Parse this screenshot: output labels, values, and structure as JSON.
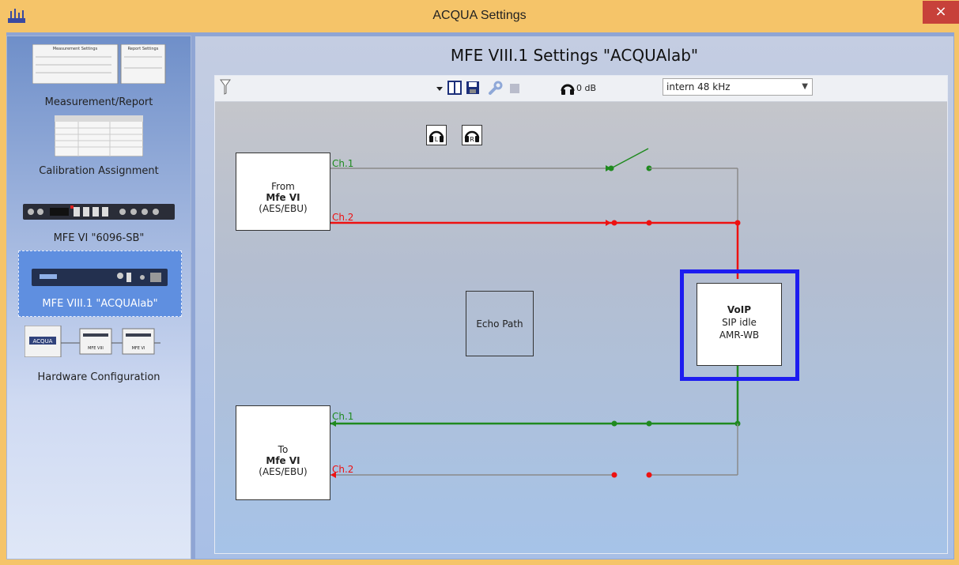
{
  "window": {
    "title": "ACQUA Settings",
    "close_glyph": "×"
  },
  "sidebar": {
    "items": [
      {
        "label": "Measurement/Report",
        "selected": false
      },
      {
        "label": "Calibration Assignment",
        "selected": false
      },
      {
        "label": "MFE VI \"6096-SB\"",
        "selected": false
      },
      {
        "label": "MFE VIII.1 \"ACQUAlab\"",
        "selected": true
      },
      {
        "label": "Hardware Configuration",
        "selected": false
      }
    ],
    "thumb_text": {
      "measurement_settings": "Measurement Settings",
      "report_settings": "Report Settings",
      "acqua_logo": "ACQUA",
      "mfe_thumb_1": "MFE VIII",
      "mfe_thumb_2": "MFE VI"
    }
  },
  "main": {
    "title": "MFE VIII.1 Settings \"ACQUAlab\"",
    "toolbar": {
      "level_label": "0 dB",
      "sample_rate": "intern 48 kHz"
    },
    "diagram": {
      "from_box": {
        "line1": "From",
        "line2": "Mfe VI",
        "line3": "(AES/EBU)"
      },
      "to_box": {
        "line1": "To",
        "line2": "Mfe VI",
        "line3": "(AES/EBU)"
      },
      "echo_box": {
        "label": "Echo Path"
      },
      "voip_box": {
        "line1": "VoIP",
        "line2": "SIP idle",
        "line3": "AMR-WB"
      },
      "ch1_label": "Ch.1",
      "ch2_label": "Ch.2",
      "hp_left": "L",
      "hp_right": "R",
      "colors": {
        "ch1": "#1f8a1f",
        "ch2": "#ee1111",
        "idle": "#8a8a8a",
        "voip_frame": "#1d1cf0"
      }
    }
  }
}
